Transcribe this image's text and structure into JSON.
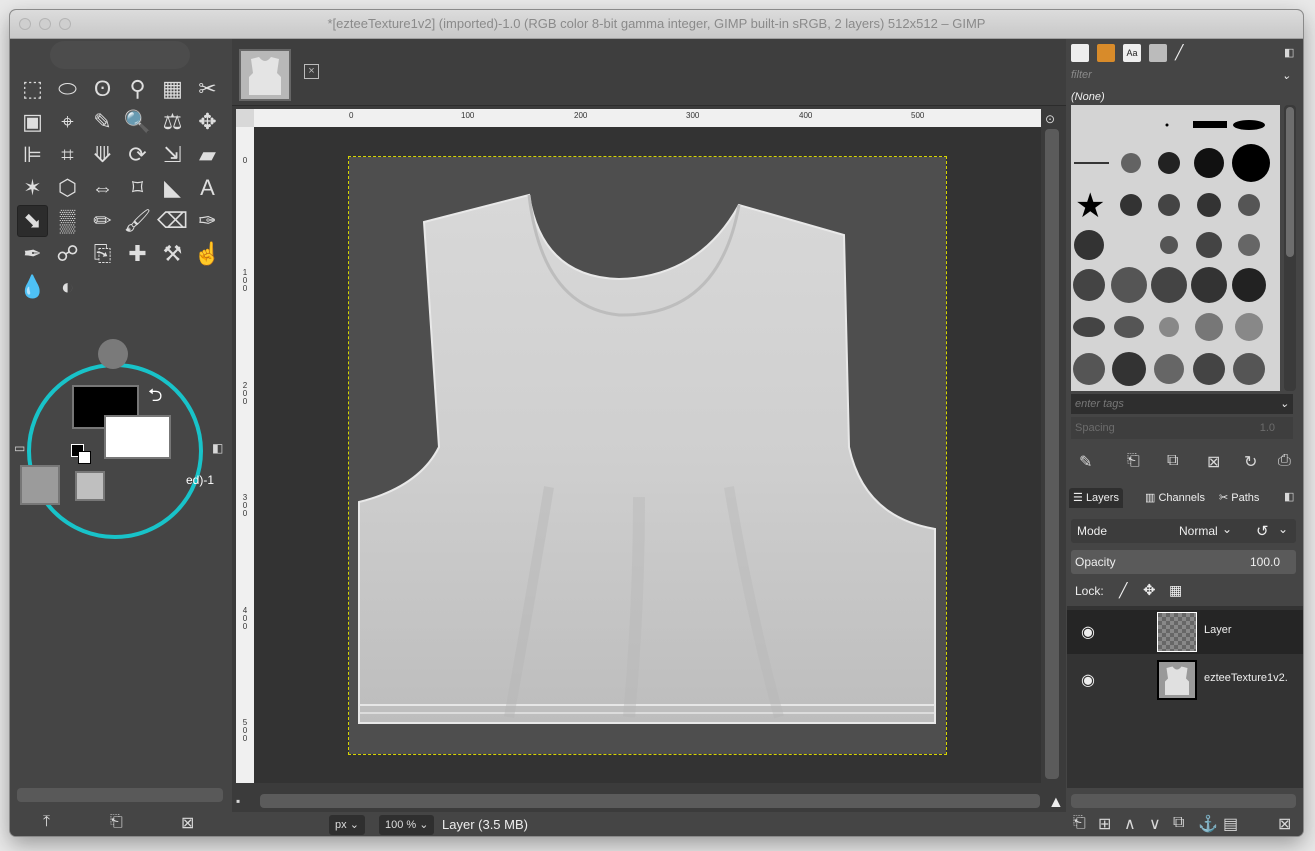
{
  "window": {
    "title": "*[ezteeTexture1v2] (imported)-1.0 (RGB color 8-bit gamma integer, GIMP built-in sRGB, 2 layers) 512x512 – GIMP"
  },
  "toolbox": {
    "tools": [
      {
        "name": "rect-select-icon",
        "glyph": "⬚"
      },
      {
        "name": "ellipse-select-icon",
        "glyph": "⬭"
      },
      {
        "name": "free-select-icon",
        "glyph": "ʘ"
      },
      {
        "name": "fuzzy-select-icon",
        "glyph": "⚲"
      },
      {
        "name": "select-by-color-icon",
        "glyph": "▦"
      },
      {
        "name": "scissors-select-icon",
        "glyph": "✂"
      },
      {
        "name": "foreground-select-icon",
        "glyph": "▣"
      },
      {
        "name": "paths-icon",
        "glyph": "⌖"
      },
      {
        "name": "color-picker-icon",
        "glyph": "✎"
      },
      {
        "name": "zoom-icon",
        "glyph": "🔍"
      },
      {
        "name": "measure-icon",
        "glyph": "⚖"
      },
      {
        "name": "move-icon",
        "glyph": "✥"
      },
      {
        "name": "align-icon",
        "glyph": "⊫"
      },
      {
        "name": "crop-icon",
        "glyph": "⌗"
      },
      {
        "name": "unified-transform-icon",
        "glyph": "⟱"
      },
      {
        "name": "rotate-icon",
        "glyph": "⟳"
      },
      {
        "name": "scale-icon",
        "glyph": "⇲"
      },
      {
        "name": "shear-icon",
        "glyph": "▰"
      },
      {
        "name": "warp-transform-icon",
        "glyph": "✶"
      },
      {
        "name": "perspective-icon",
        "glyph": "⬡"
      },
      {
        "name": "flip-icon",
        "glyph": "⇔"
      },
      {
        "name": "cage-transform-icon",
        "glyph": "⌑"
      },
      {
        "name": "warp-icon",
        "glyph": "◣"
      },
      {
        "name": "text-icon",
        "glyph": "A"
      },
      {
        "name": "bucket-fill-icon",
        "glyph": "⬊"
      },
      {
        "name": "gradient-icon",
        "glyph": "▒"
      },
      {
        "name": "pencil-icon",
        "glyph": "✏"
      },
      {
        "name": "paintbrush-icon",
        "glyph": "🖌"
      },
      {
        "name": "eraser-icon",
        "glyph": "⌫"
      },
      {
        "name": "airbrush-icon",
        "glyph": "✑"
      },
      {
        "name": "ink-icon",
        "glyph": "✒"
      },
      {
        "name": "mypaint-brush-icon",
        "glyph": "☍"
      },
      {
        "name": "clone-icon",
        "glyph": "⎘"
      },
      {
        "name": "heal-icon",
        "glyph": "✚"
      },
      {
        "name": "perspective-clone-icon",
        "glyph": "⚒"
      },
      {
        "name": "smudge-icon",
        "glyph": "☝"
      },
      {
        "name": "blur-icon",
        "glyph": "💧"
      },
      {
        "name": "dodge-burn-icon",
        "glyph": "◐"
      }
    ],
    "active_tool_index": 24,
    "image_tab_label": "ed)-1"
  },
  "canvas": {
    "ruler_h_labels": [
      "0",
      "100",
      "200",
      "300",
      "400",
      "500"
    ],
    "ruler_v_labels": [
      "0",
      "1 0 0",
      "2 0 0",
      "3 0 0",
      "4 0 0",
      "5 0 0"
    ],
    "unit": "px",
    "zoom": "100 %",
    "status": "Layer (3.5 MB)"
  },
  "brushes": {
    "filter_placeholder": "filter",
    "current": "(None)",
    "tags_placeholder": "enter tags",
    "spacing_label": "Spacing",
    "spacing_value": "1.0"
  },
  "layers_panel": {
    "tabs": [
      "Layers",
      "Channels",
      "Paths"
    ],
    "mode_label": "Mode",
    "mode_value": "Normal",
    "opacity_label": "Opacity",
    "opacity_value": "100.0",
    "lock_label": "Lock:",
    "layers": [
      {
        "name": "Layer",
        "selected": true,
        "visible": true
      },
      {
        "name": "ezteeTexture1v2.",
        "selected": false,
        "visible": true
      }
    ]
  },
  "colors": {
    "accent_circle": "#18c3c9",
    "foreground": "#000000",
    "background": "#ffffff"
  }
}
